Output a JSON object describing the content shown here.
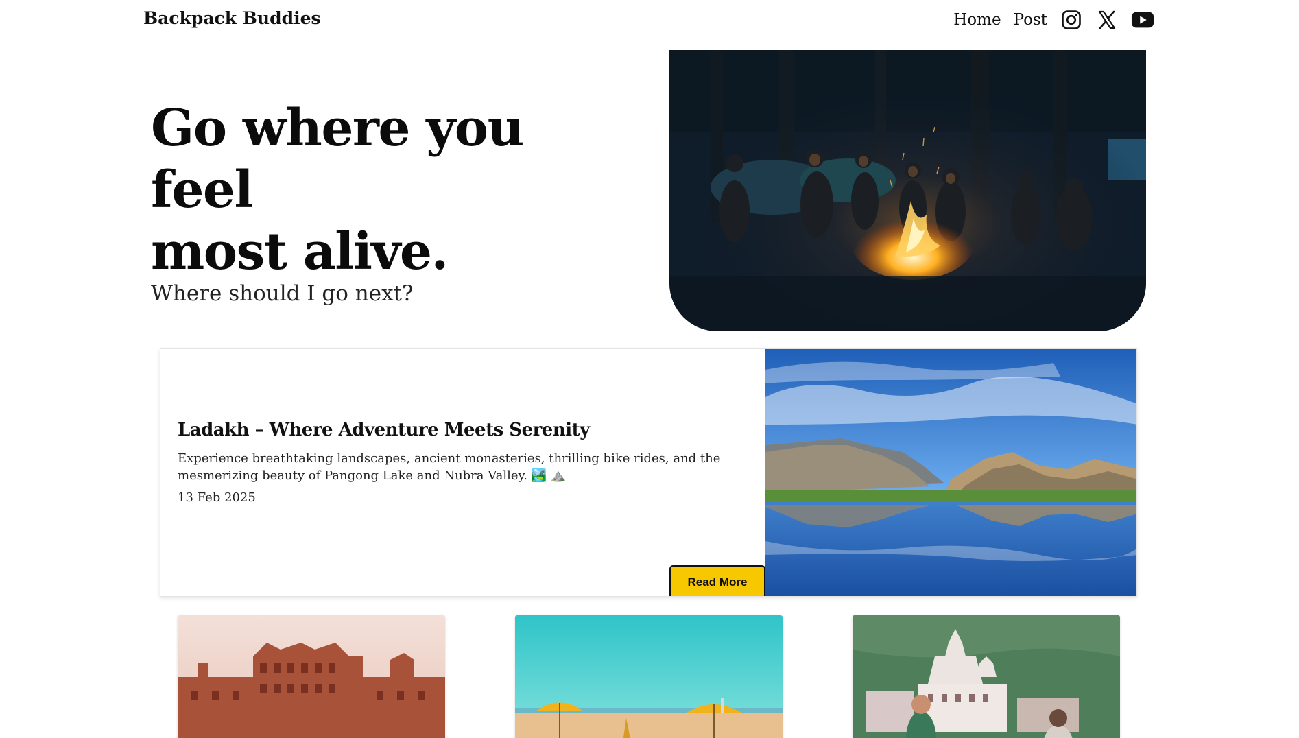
{
  "header": {
    "brand": "Backpack Buddies",
    "nav": [
      {
        "label": "Home"
      },
      {
        "label": "Post"
      }
    ],
    "social_icons": [
      "instagram-icon",
      "x-icon",
      "youtube-icon"
    ]
  },
  "hero": {
    "title_line1": "Go where you feel",
    "title_line2": "most alive.",
    "subtitle": "Where should I go next?"
  },
  "featured": {
    "title": "Ladakh – Where Adventure Meets Serenity",
    "description": "Experience breathtaking landscapes, ancient monasteries, thrilling bike rides, and the mesmerizing beauty of Pangong Lake and Nubra Valley. 🏞️ ⛰️",
    "date": "13 Feb 2025",
    "button_label": "Read More",
    "button_color": "#f7c800"
  },
  "posts": [
    {
      "image": "hawa-mahal-photo"
    },
    {
      "image": "beach-umbrellas-photo"
    },
    {
      "image": "rishikesh-temple-photo"
    }
  ]
}
